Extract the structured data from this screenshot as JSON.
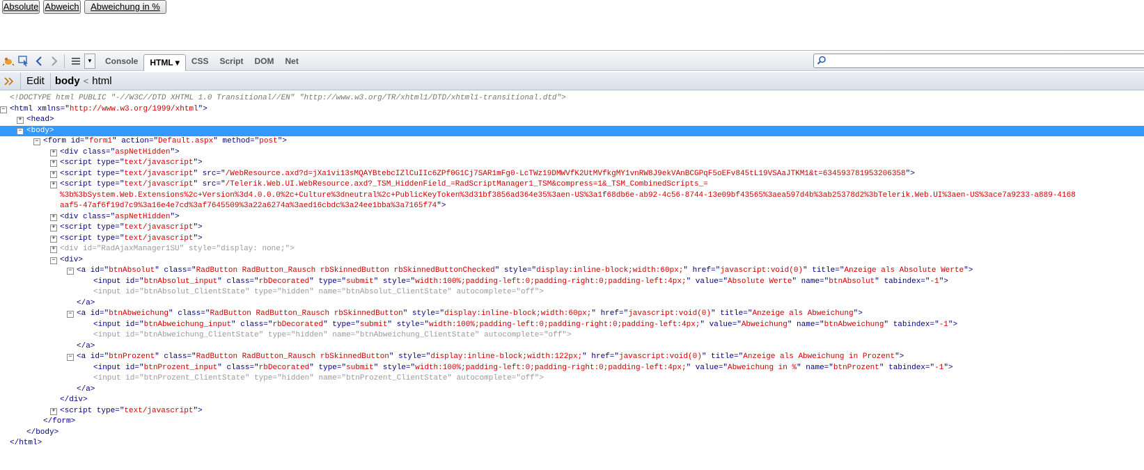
{
  "page_buttons": [
    {
      "label": "Absolute"
    },
    {
      "label": "Abweich"
    },
    {
      "label": "Abweichung in %"
    }
  ],
  "toolbar": {
    "tabs": [
      {
        "label": "Console"
      },
      {
        "label": "HTML ▾"
      },
      {
        "label": "CSS"
      },
      {
        "label": "Script"
      },
      {
        "label": "DOM"
      },
      {
        "label": "Net"
      }
    ],
    "search_placeholder": ""
  },
  "breadcrumb": {
    "edit_label": "Edit",
    "current": "body",
    "separator": "<",
    "parent": "html"
  },
  "tree": {
    "doctype": "<!DOCTYPE html PUBLIC \"-//W3C//DTD XHTML 1.0 Transitional//EN\" \"http://www.w3.org/TR/xhtml1/DTD/xhtml1-transitional.dtd\">",
    "html_open": "<html xmlns=\"",
    "html_xmlns": "http://www.w3.org/1999/xhtml",
    "html_close": "\">",
    "head": "<head>",
    "body": "<body>",
    "form_parts": [
      "<form id=\"",
      "form1",
      "\" action=\"",
      "Default.aspx",
      "\" method=\"",
      "post",
      "\">"
    ],
    "div_hidden_1": [
      "<div class=\"",
      "aspNetHidden",
      "\">"
    ],
    "script_1": [
      "<script type=\"",
      "text/javascript",
      "\">"
    ],
    "script_2": [
      "<script type=\"",
      "text/javascript",
      "\" src=\"",
      "/WebResource.axd?d=jXa1vi13sMQAYBtebcIZlCuIIc6ZPf0G1Cj7SAR1mFg0-LcTWz19DMWVfK2UtMVfkgMY1vnRW8J9ekVAnBCGPqF5oEFv845tL19VSAaJTKM1&t=634593781953206358",
      "\">"
    ],
    "script_3_a": [
      "<script type=\"",
      "text/javascript",
      "\" src=\"",
      "/Telerik.Web.UI.WebResource.axd?_TSM_HiddenField_=RadScriptManager1_TSM&compress=1&_TSM_CombinedScripts_="
    ],
    "script_3_b": "%3b%3bSystem.Web.Extensions%2c+Version%3d4.0.0.0%2c+Culture%3dneutral%2c+PublicKeyToken%3d31bf3856ad364e35%3aen-US%3a1f68db6e-ab92-4c56-8744-13e09bf43565%3aea597d4b%3ab25378d2%3bTelerik.Web.UI%3aen-US%3ace7a9233-a889-4168",
    "script_3_c": [
      "aaf5-47af6f19d7c9%3a16e4e7cd%3af7645509%3a22a6274a%3aed16cbdc%3a24ee1bba%3a7165f74",
      "\">"
    ],
    "div_hidden_2": [
      "<div class=\"",
      "aspNetHidden",
      "\">"
    ],
    "script_4": [
      "<script type=\"",
      "text/javascript",
      "\">"
    ],
    "script_5": [
      "<script type=\"",
      "text/javascript",
      "\">"
    ],
    "div_ajax": [
      "<div id=\"",
      "RadAjaxManager1SU",
      "\" style=\"",
      "display: none;",
      "\">"
    ],
    "div_open": "<div>",
    "a1": [
      "<a id=\"",
      "btnAbsolut",
      "\" class=\"",
      "RadButton RadButton_Rausch rbSkinnedButton rbSkinnedButtonChecked",
      "\" style=\"",
      "display:inline-block;width:60px;",
      "\" href=\"",
      "javascript:void(0)",
      "\" title=\"",
      "Anzeige als Absolute Werte",
      "\">"
    ],
    "a1_input": [
      "<input id=\"",
      "btnAbsolut_input",
      "\" class=\"",
      "rbDecorated",
      "\" type=\"",
      "submit",
      "\" style=\"",
      "width:100%;padding-left:0;padding-right:0;padding-left:4px;",
      "\" value=\"",
      "Absolute Werte",
      "\" name=\"",
      "btnAbsolut",
      "\" tabindex=\"",
      "-1",
      "\">"
    ],
    "a1_state": [
      "<input id=\"",
      "btnAbsolut_ClientState",
      "\" type=\"",
      "hidden",
      "\" name=\"",
      "btnAbsolut_ClientState",
      "\" autocomplete=\"",
      "off",
      "\">"
    ],
    "a_close": "</a>",
    "a2": [
      "<a id=\"",
      "btnAbweichung",
      "\" class=\"",
      "RadButton RadButton_Rausch rbSkinnedButton",
      "\" style=\"",
      "display:inline-block;width:60px;",
      "\" href=\"",
      "javascript:void(0)",
      "\" title=\"",
      "Anzeige als Abweichung",
      "\">"
    ],
    "a2_input": [
      "<input id=\"",
      "btnAbweichung_input",
      "\" class=\"",
      "rbDecorated",
      "\" type=\"",
      "submit",
      "\" style=\"",
      "width:100%;padding-left:0;padding-right:0;padding-left:4px;",
      "\" value=\"",
      "Abweichung",
      "\" name=\"",
      "btnAbweichung",
      "\" tabindex=\"",
      "-1",
      "\">"
    ],
    "a2_state": [
      "<input id=\"",
      "btnAbweichung_ClientState",
      "\" type=\"",
      "hidden",
      "\" name=\"",
      "btnAbweichung_ClientState",
      "\" autocomplete=\"",
      "off",
      "\">"
    ],
    "a3": [
      "<a id=\"",
      "btnProzent",
      "\" class=\"",
      "RadButton RadButton_Rausch rbSkinnedButton",
      "\" style=\"",
      "display:inline-block;width:122px;",
      "\" href=\"",
      "javascript:void(0)",
      "\" title=\"",
      "Anzeige als Abweichung in Prozent",
      "\">"
    ],
    "a3_input": [
      "<input id=\"",
      "btnProzent_input",
      "\" class=\"",
      "rbDecorated",
      "\" type=\"",
      "submit",
      "\" style=\"",
      "width:100%;padding-left:0;padding-right:0;padding-left:4px;",
      "\" value=\"",
      "Abweichung in %",
      "\" name=\"",
      "btnProzent",
      "\" tabindex=\"",
      "-1",
      "\">"
    ],
    "a3_state": [
      "<input id=\"",
      "btnProzent_ClientState",
      "\" type=\"",
      "hidden",
      "\" name=\"",
      "btnProzent_ClientState",
      "\" autocomplete=\"",
      "off",
      "\">"
    ],
    "div_close": "</div>",
    "script_6": [
      "<script type=\"",
      "text/javascript",
      "\">"
    ],
    "form_close": "</form>",
    "body_close": "</body>",
    "html_end": "</html>"
  }
}
